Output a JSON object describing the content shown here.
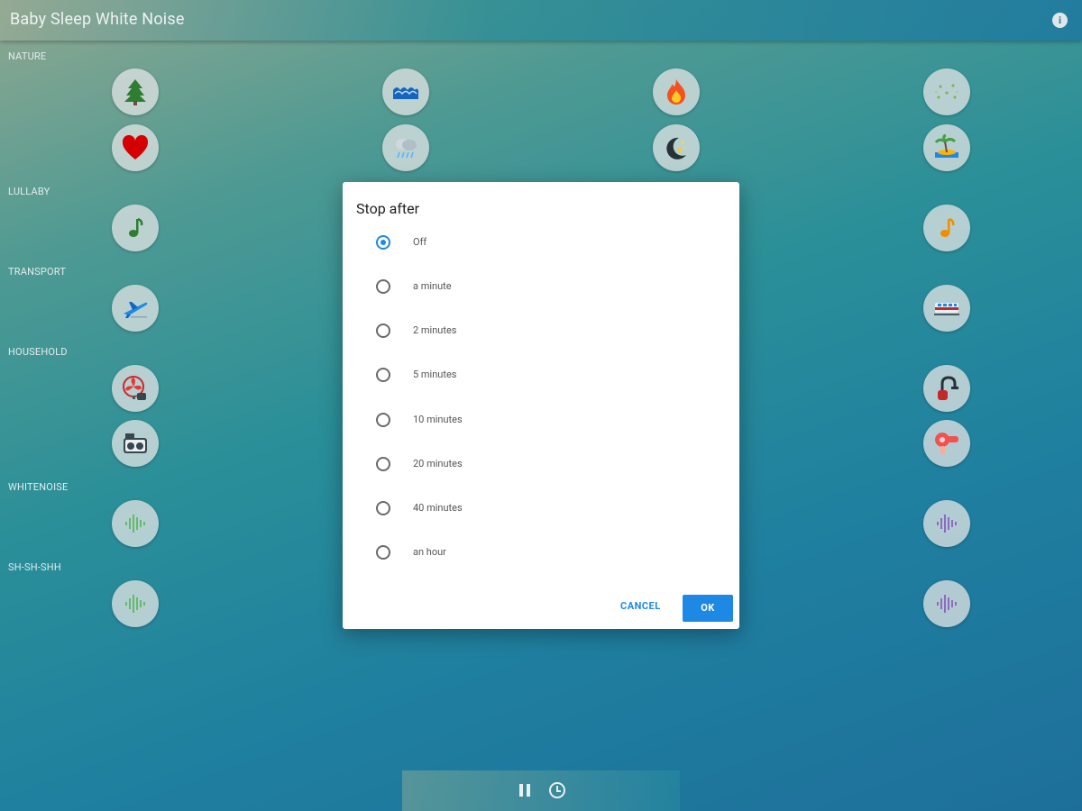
{
  "app": {
    "title": "Baby Sleep White Noise"
  },
  "sections": {
    "nature": "NATURE",
    "lullaby": "LULLABY",
    "transport": "TRANSPORT",
    "household": "HOUSEHOLD",
    "whitenoise": "WHITENOISE",
    "shshshh": "SH-SH-SHH"
  },
  "sounds": [
    {
      "icon": "pine-tree-icon"
    },
    {
      "icon": "ocean-waves-icon"
    },
    {
      "icon": "fire-icon"
    },
    {
      "icon": "crickets-icon"
    },
    {
      "icon": "heart-icon"
    },
    {
      "icon": "rain-cloud-icon"
    },
    {
      "icon": "night-moon-icon"
    },
    {
      "icon": "island-icon"
    },
    {
      "icon": "music-note-green-icon"
    },
    {
      "icon": "music-note-orange-icon"
    },
    {
      "icon": "airplane-icon"
    },
    {
      "icon": "train-icon"
    },
    {
      "icon": "fan-icon"
    },
    {
      "icon": "vacuum-icon"
    },
    {
      "icon": "washing-machine-icon"
    },
    {
      "icon": "hair-dryer-icon"
    },
    {
      "icon": "waveform-green-icon"
    },
    {
      "icon": "waveform-purple-icon"
    },
    {
      "icon": "waveform-green-icon"
    },
    {
      "icon": "waveform-purple-icon"
    }
  ],
  "dialog": {
    "title": "Stop after",
    "options": [
      {
        "label": "Off",
        "selected": true
      },
      {
        "label": "a minute",
        "selected": false
      },
      {
        "label": "2 minutes",
        "selected": false
      },
      {
        "label": "5 minutes",
        "selected": false
      },
      {
        "label": "10 minutes",
        "selected": false
      },
      {
        "label": "20 minutes",
        "selected": false
      },
      {
        "label": "40 minutes",
        "selected": false
      },
      {
        "label": "an hour",
        "selected": false
      }
    ],
    "cancel_label": "CANCEL",
    "ok_label": "OK"
  },
  "player": {
    "pause_icon": "pause-icon",
    "timer_icon": "timer-icon"
  },
  "colors": {
    "accent": "#1e88e5"
  }
}
